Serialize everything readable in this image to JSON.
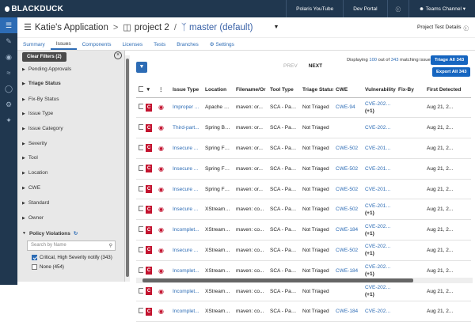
{
  "topbar": {
    "logo": "BLACKDUCK",
    "links": [
      "Polaris YouTube",
      "Dev Portal"
    ],
    "help_icon": "help-circle-icon",
    "user_icon": "user-icon",
    "team": "Teams Channel"
  },
  "leftnav": {
    "icons": [
      "layers-icon",
      "wrench-icon",
      "radar-icon",
      "chart-icon",
      "shield-icon",
      "settings-icon",
      "sparkle-icon"
    ]
  },
  "header": {
    "app": "Katie's Application",
    "project": "project 2",
    "branch": "master (default)",
    "project_details": "Project Test Details"
  },
  "tabs": [
    "Summary",
    "Issues",
    "Components",
    "Licenses",
    "Tests",
    "Branches",
    "Settings"
  ],
  "active_tab": "Issues",
  "filters": {
    "clear_label": "Clear Filters (2)",
    "sections": [
      "Pending Approvals",
      "Triage Status",
      "Fix-By Status",
      "Issue Type",
      "Issue Category",
      "Severity",
      "Tool",
      "Location",
      "CWE",
      "Standard",
      "Owner"
    ],
    "bold_sections": [
      "Triage Status"
    ],
    "policy": {
      "title": "Policy Violations",
      "search_placeholder": "Search by Name",
      "options": [
        {
          "label": "Critical, High Severity notify (343)",
          "checked": true
        },
        {
          "label": "None (454)",
          "checked": false
        }
      ]
    }
  },
  "pager": {
    "prev": "PREV",
    "next": "NEXT",
    "displaying_prefix": "Displaying ",
    "displaying_count": "100",
    "displaying_mid": " out of ",
    "displaying_total": "343",
    "displaying_suffix": " matching issues",
    "triage_all": "Triage All 343",
    "export_all": "Export All 343"
  },
  "table": {
    "columns": [
      "",
      "",
      "",
      "Issue Type",
      "Location",
      "Filename/Or",
      "Tool Type",
      "Triage Status",
      "CWE",
      "Vulnerability",
      "Fix-By",
      "First Detected"
    ],
    "rows": [
      [
        "Improper ...",
        "Apache C...",
        "maven: or...",
        "SCA - Pac...",
        "Not Triaged",
        "CWE-94",
        "CVE-2022-42",
        "(+1)",
        "",
        "Aug 21, 2..."
      ],
      [
        "Third-part...",
        "Spring Bo...",
        "maven: or...",
        "SCA - Pac...",
        "Not Triaged",
        "",
        "CVE-2023-20",
        "",
        "",
        "Aug 21, 2..."
      ],
      [
        "Insecure ...",
        "Spring Fra...",
        "maven: or...",
        "SCA - Pac...",
        "Not Triaged",
        "CWE-502",
        "CVE-2016-10",
        "",
        "",
        "Aug 21, 2..."
      ],
      [
        "Insecure ...",
        "Spring Fra...",
        "maven: or...",
        "SCA - Pac...",
        "Not Triaged",
        "CWE-502",
        "CVE-2016-10",
        "",
        "",
        "Aug 21, 2..."
      ],
      [
        "Insecure ...",
        "Spring Fra...",
        "maven: or...",
        "SCA - Pac...",
        "Not Triaged",
        "CWE-502",
        "CVE-2016-10",
        "",
        "",
        "Aug 21, 2..."
      ],
      [
        "Insecure ...",
        "XStream 1...",
        "maven: co...",
        "SCA - Pac...",
        "Not Triaged",
        "CWE-502",
        "CVE-2013-72",
        "(+1)",
        "",
        "Aug 21, 2..."
      ],
      [
        "Incomplet...",
        "XStream 1...",
        "maven: co...",
        "SCA - Pac...",
        "Not Triaged",
        "CWE-184",
        "CVE-2020-26",
        "(+1)",
        "",
        "Aug 21, 2..."
      ],
      [
        "Insecure ...",
        "XStream 1...",
        "maven: co...",
        "SCA - Pac...",
        "Not Triaged",
        "CWE-502",
        "CVE-2020-26",
        "(+1)",
        "",
        "Aug 21, 2..."
      ],
      [
        "Incomplet...",
        "XStream 1...",
        "maven: co...",
        "SCA - Pac...",
        "Not Triaged",
        "CWE-184",
        "CVE-2021-39",
        "(+1)",
        "",
        "Aug 21, 2..."
      ],
      [
        "Incomplet...",
        "XStream 1...",
        "maven: co...",
        "SCA - Pac...",
        "Not Triaged",
        "",
        "CVE-2021-39",
        "(+1)",
        "",
        "Aug 21, 2..."
      ],
      [
        "Incomplet...",
        "XStream 1...",
        "maven: co...",
        "SCA - Pac...",
        "Not Triaged",
        "CWE-184",
        "CVE-2021-39",
        "",
        "",
        "Aug 21, 2..."
      ]
    ],
    "severity_badge": "C"
  },
  "colors": {
    "nav_bg": "#20374f",
    "accent": "#2d6cb5",
    "critical": "#c3132f"
  }
}
